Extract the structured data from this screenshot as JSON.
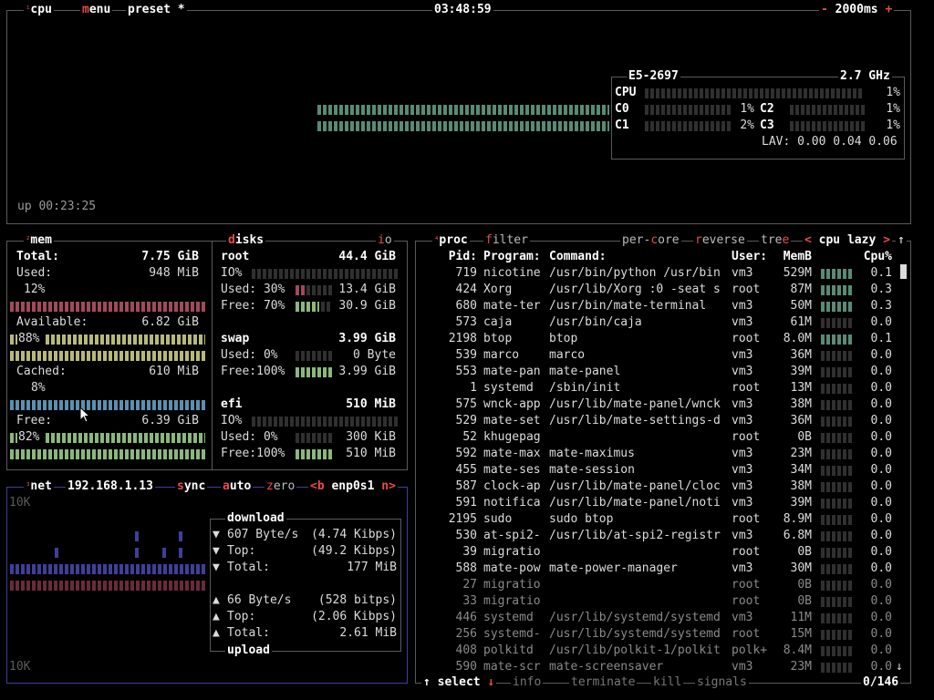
{
  "cpu": {
    "sup": "¹",
    "title": "cpu",
    "menu_hot": "m",
    "menu_rest": "enu",
    "preset": "preset *",
    "clock": "03:48:59",
    "minus": "-",
    "interval": "2000ms",
    "plus": "+",
    "uptime": "up 00:23:25",
    "model": "E5-2697",
    "freq": "2.7 GHz",
    "total_label": "CPU",
    "total_pct": "1%",
    "cores": [
      {
        "label": "C0",
        "pct": "1%"
      },
      {
        "label": "C1",
        "pct": "2%"
      },
      {
        "label": "C2",
        "pct": "1%"
      },
      {
        "label": "C3",
        "pct": "1%"
      }
    ],
    "lav": "LAV: 0.00 0.04 0.06"
  },
  "mem": {
    "sup": "²",
    "title": "mem",
    "total_label": "Total:",
    "total_value": "7.75 GiB",
    "used_label": "Used:",
    "used_value": "948 MiB",
    "used_pct": "12%",
    "available_label": "Available:",
    "available_value": "6.82 GiB",
    "available_pct": "88%",
    "cached_label": "Cached:",
    "cached_value": "610 MiB",
    "cached_pct": "8%",
    "free_label": "Free:",
    "free_value": "6.39 GiB",
    "free_pct": "82%"
  },
  "disks": {
    "title_hot": "d",
    "title_rest": "isks",
    "io_hot": "i",
    "io_rest": "o",
    "root": {
      "name": "root",
      "size": "44.4 GiB",
      "io": "IO%",
      "used_label": "Used: 30%",
      "used_value": "13.4 GiB",
      "free_label": "Free: 70%",
      "free_value": "30.9 GiB"
    },
    "swap": {
      "name": "swap",
      "size": "3.99 GiB",
      "used_label": "Used:  0%",
      "used_value": "0 Byte",
      "free_label": "Free:100%",
      "free_value": "3.99 GiB"
    },
    "efi": {
      "name": "efi",
      "size": "510 MiB",
      "io": "IO%",
      "used_label": "Used:  0%",
      "used_value": "300 KiB",
      "free_label": "Free:100%",
      "free_value": "510 MiB"
    }
  },
  "net": {
    "sup": "³",
    "title": "net",
    "ip": "192.168.1.13",
    "sync_hot": "s",
    "sync_rest": "ync",
    "auto_hot": "a",
    "auto_rest": "uto",
    "zero_hot": "z",
    "zero_rest": "ero",
    "prev": "<b",
    "iface": "enp0s1",
    "next": "n>",
    "scale_top": "10K",
    "scale_bottom": "10K",
    "download_title": "download",
    "upload_title": "upload",
    "dl_rate": "607 Byte/s",
    "dl_rate_bits": "(4.74 Kibps)",
    "dl_top_label": "Top:",
    "dl_top": "(49.2 Kibps)",
    "dl_total_label": "Total:",
    "dl_total": "177 MiB",
    "ul_rate": "66 Byte/s",
    "ul_rate_bits": "(528 bitps)",
    "ul_top_label": "Top:",
    "ul_top": "(2.06 Kibps)",
    "ul_total_label": "Total:",
    "ul_total": "2.61 MiB"
  },
  "proc": {
    "sup": "⁴",
    "title": "proc",
    "filter_hot": "f",
    "filter_rest": "ilter",
    "percore_a": "per-",
    "percore_hot": "c",
    "percore_b": "ore",
    "reverse_hot": "r",
    "reverse_rest": "everse",
    "tree_a": "tre",
    "tree_hot": "e",
    "sort_left": "<",
    "sort_label": "cpu lazy",
    "sort_right": ">",
    "headers": {
      "pid": "Pid:",
      "program": "Program:",
      "command": "Command:",
      "user": "User:",
      "mem": "MemB",
      "cpu": "Cpu%"
    },
    "rows": [
      {
        "pid": "719",
        "program": "nicotine",
        "command": "/usr/bin/python /usr/bin",
        "user": "vm3",
        "mem": "529M",
        "cpu": "0.1"
      },
      {
        "pid": "424",
        "program": "Xorg",
        "command": "/usr/lib/Xorg :0 -seat s",
        "user": "root",
        "mem": "87M",
        "cpu": "0.3"
      },
      {
        "pid": "680",
        "program": "mate-ter",
        "command": "/usr/bin/mate-terminal",
        "user": "vm3",
        "mem": "50M",
        "cpu": "0.3"
      },
      {
        "pid": "573",
        "program": "caja",
        "command": "/usr/bin/caja",
        "user": "vm3",
        "mem": "61M",
        "cpu": "0.0"
      },
      {
        "pid": "2198",
        "program": "btop",
        "command": "btop",
        "user": "root",
        "mem": "8.0M",
        "cpu": "0.1"
      },
      {
        "pid": "539",
        "program": "marco",
        "command": "marco",
        "user": "vm3",
        "mem": "36M",
        "cpu": "0.0"
      },
      {
        "pid": "553",
        "program": "mate-pan",
        "command": "mate-panel",
        "user": "vm3",
        "mem": "39M",
        "cpu": "0.0"
      },
      {
        "pid": "1",
        "program": "systemd",
        "command": "/sbin/init",
        "user": "root",
        "mem": "13M",
        "cpu": "0.0"
      },
      {
        "pid": "575",
        "program": "wnck-app",
        "command": "/usr/lib/mate-panel/wnck",
        "user": "vm3",
        "mem": "38M",
        "cpu": "0.0"
      },
      {
        "pid": "529",
        "program": "mate-set",
        "command": "/usr/lib/mate-settings-d",
        "user": "vm3",
        "mem": "36M",
        "cpu": "0.0"
      },
      {
        "pid": "52",
        "program": "khugepag",
        "command": "",
        "user": "root",
        "mem": "0B",
        "cpu": "0.0"
      },
      {
        "pid": "592",
        "program": "mate-max",
        "command": "mate-maximus",
        "user": "vm3",
        "mem": "23M",
        "cpu": "0.0"
      },
      {
        "pid": "455",
        "program": "mate-ses",
        "command": "mate-session",
        "user": "vm3",
        "mem": "34M",
        "cpu": "0.0"
      },
      {
        "pid": "587",
        "program": "clock-ap",
        "command": "/usr/lib/mate-panel/cloc",
        "user": "vm3",
        "mem": "38M",
        "cpu": "0.0"
      },
      {
        "pid": "591",
        "program": "notifica",
        "command": "/usr/lib/mate-panel/noti",
        "user": "vm3",
        "mem": "39M",
        "cpu": "0.0"
      },
      {
        "pid": "2195",
        "program": "sudo",
        "command": "sudo btop",
        "user": "root",
        "mem": "8.9M",
        "cpu": "0.0"
      },
      {
        "pid": "530",
        "program": "at-spi2-",
        "command": "/usr/lib/at-spi2-registr",
        "user": "vm3",
        "mem": "6.8M",
        "cpu": "0.0"
      },
      {
        "pid": "39",
        "program": "migratio",
        "command": "",
        "user": "root",
        "mem": "0B",
        "cpu": "0.0"
      },
      {
        "pid": "588",
        "program": "mate-pow",
        "command": "mate-power-manager",
        "user": "vm3",
        "mem": "30M",
        "cpu": "0.0"
      },
      {
        "pid": "27",
        "program": "migratio",
        "command": "",
        "user": "root",
        "mem": "0B",
        "cpu": "0.0"
      },
      {
        "pid": "33",
        "program": "migratio",
        "command": "",
        "user": "root",
        "mem": "0B",
        "cpu": "0.0"
      },
      {
        "pid": "446",
        "program": "systemd",
        "command": "/usr/lib/systemd/systemd",
        "user": "vm3",
        "mem": "11M",
        "cpu": "0.0"
      },
      {
        "pid": "256",
        "program": "systemd-",
        "command": "/usr/lib/systemd/systemd",
        "user": "root",
        "mem": "15M",
        "cpu": "0.0"
      },
      {
        "pid": "408",
        "program": "polkitd",
        "command": "/usr/lib/polkit-1/polkit",
        "user": "polk+",
        "mem": "8.4M",
        "cpu": "0.0"
      },
      {
        "pid": "590",
        "program": "mate-scr",
        "command": "mate-screensaver",
        "user": "vm3",
        "mem": "23M",
        "cpu": "0.0"
      }
    ],
    "up_arrow": "↑",
    "down_arrow": "↓",
    "select_label": "select",
    "info_label": "info",
    "terminate_label": "terminate",
    "kill_label": "kill",
    "signals_label": "signals",
    "count": "0/146"
  }
}
